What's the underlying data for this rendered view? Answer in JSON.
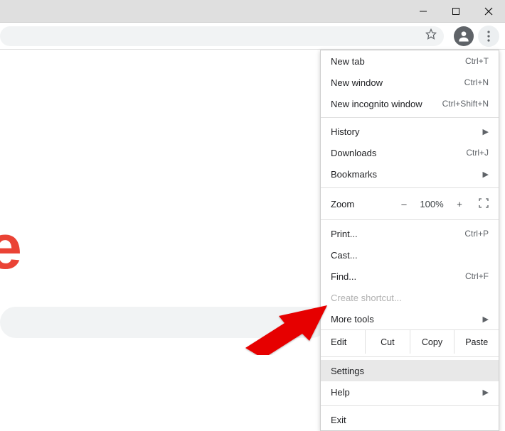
{
  "window": {
    "minimize": "–",
    "maximize": "❐",
    "close": "✕"
  },
  "toolbar": {
    "star": "☆",
    "profile": "",
    "kebab": "⋮"
  },
  "page": {
    "letter": "e"
  },
  "menu": {
    "new_tab": {
      "label": "New tab",
      "shortcut": "Ctrl+T"
    },
    "new_window": {
      "label": "New window",
      "shortcut": "Ctrl+N"
    },
    "new_incognito": {
      "label": "New incognito window",
      "shortcut": "Ctrl+Shift+N"
    },
    "history": {
      "label": "History"
    },
    "downloads": {
      "label": "Downloads",
      "shortcut": "Ctrl+J"
    },
    "bookmarks": {
      "label": "Bookmarks"
    },
    "zoom": {
      "label": "Zoom",
      "minus": "–",
      "value": "100%",
      "plus": "+"
    },
    "print": {
      "label": "Print...",
      "shortcut": "Ctrl+P"
    },
    "cast": {
      "label": "Cast..."
    },
    "find": {
      "label": "Find...",
      "shortcut": "Ctrl+F"
    },
    "create_shortcut": {
      "label": "Create shortcut..."
    },
    "more_tools": {
      "label": "More tools"
    },
    "edit": {
      "label": "Edit",
      "cut": "Cut",
      "copy": "Copy",
      "paste": "Paste"
    },
    "settings": {
      "label": "Settings"
    },
    "help": {
      "label": "Help"
    },
    "exit": {
      "label": "Exit"
    }
  }
}
